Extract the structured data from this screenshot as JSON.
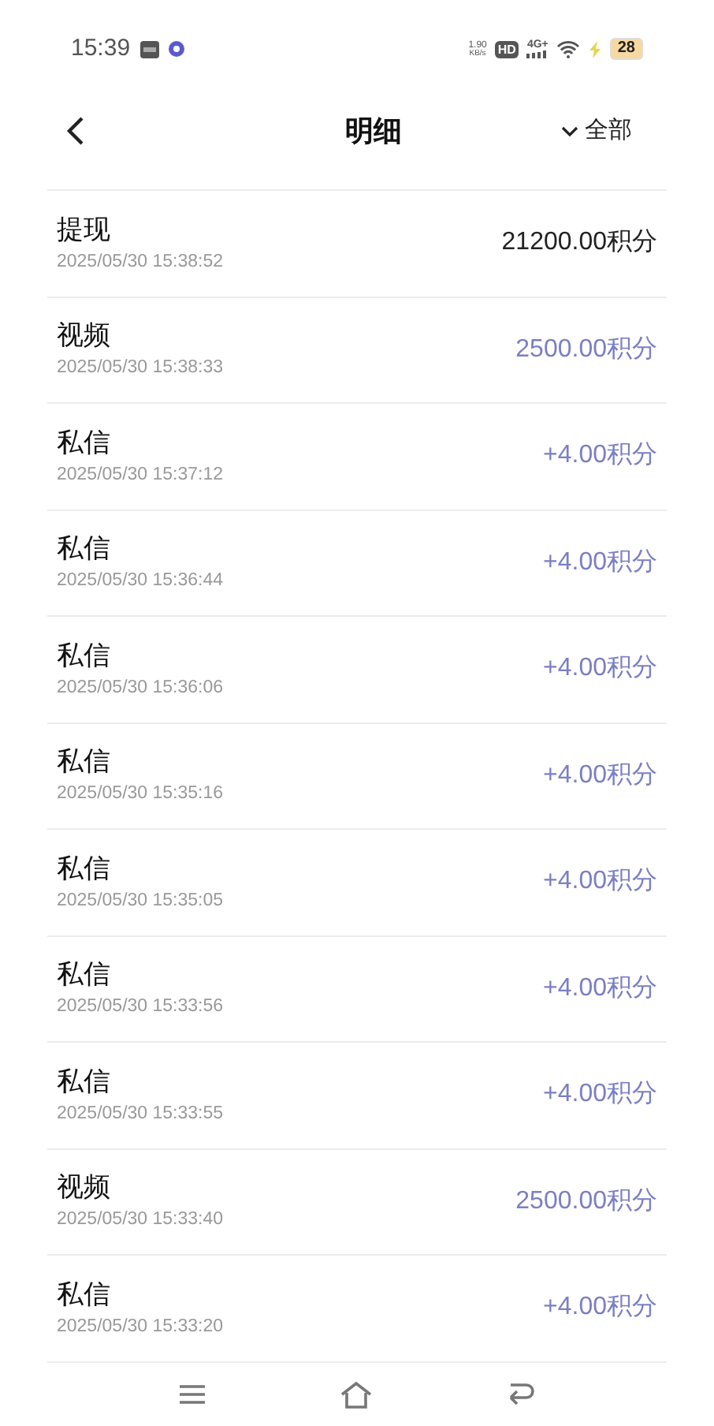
{
  "status_bar": {
    "time": "15:39",
    "net_speed": "1.90",
    "net_unit": "KB/s",
    "hd": "HD",
    "network": "4G+",
    "battery": "28"
  },
  "header": {
    "title": "明细",
    "filter": "全部"
  },
  "records": [
    {
      "title": "提现",
      "time": "2025/05/30 15:38:52",
      "amount": "21200.00积分",
      "kind": "debit"
    },
    {
      "title": "视频",
      "time": "2025/05/30 15:38:33",
      "amount": "2500.00积分",
      "kind": "credit"
    },
    {
      "title": "私信",
      "time": "2025/05/30 15:37:12",
      "amount": "+4.00积分",
      "kind": "credit"
    },
    {
      "title": "私信",
      "time": "2025/05/30 15:36:44",
      "amount": "+4.00积分",
      "kind": "credit"
    },
    {
      "title": "私信",
      "time": "2025/05/30 15:36:06",
      "amount": "+4.00积分",
      "kind": "credit"
    },
    {
      "title": "私信",
      "time": "2025/05/30 15:35:16",
      "amount": "+4.00积分",
      "kind": "credit"
    },
    {
      "title": "私信",
      "time": "2025/05/30 15:35:05",
      "amount": "+4.00积分",
      "kind": "credit"
    },
    {
      "title": "私信",
      "time": "2025/05/30 15:33:56",
      "amount": "+4.00积分",
      "kind": "credit"
    },
    {
      "title": "私信",
      "time": "2025/05/30 15:33:55",
      "amount": "+4.00积分",
      "kind": "credit"
    },
    {
      "title": "视频",
      "time": "2025/05/30 15:33:40",
      "amount": "2500.00积分",
      "kind": "credit"
    },
    {
      "title": "私信",
      "time": "2025/05/30 15:33:20",
      "amount": "+4.00积分",
      "kind": "credit"
    }
  ]
}
